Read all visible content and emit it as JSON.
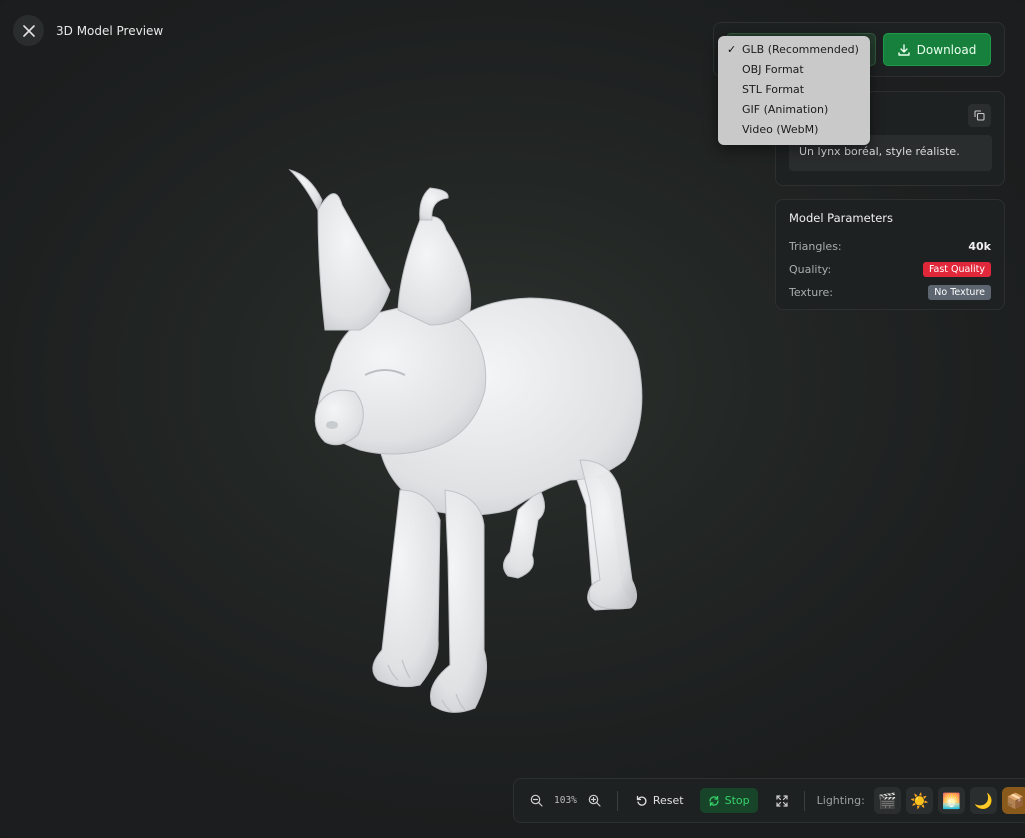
{
  "header": {
    "title": "3D Model Preview"
  },
  "download": {
    "label": "Download"
  },
  "format_menu": {
    "items": [
      {
        "label": "GLB (Recommended)",
        "checked": true
      },
      {
        "label": "OBJ Format",
        "checked": false
      },
      {
        "label": "STL Format",
        "checked": false
      },
      {
        "label": "GIF (Animation)",
        "checked": false
      },
      {
        "label": "Video (WebM)",
        "checked": false
      }
    ],
    "check_glyph": "✓"
  },
  "prompt": {
    "text": "Un lynx boréal, style réaliste."
  },
  "params": {
    "title": "Model Parameters",
    "triangles_label": "Triangles:",
    "triangles_value": "40k",
    "quality_label": "Quality:",
    "quality_value": "Fast Quality",
    "texture_label": "Texture:",
    "texture_value": "No Texture"
  },
  "toolbar": {
    "zoom_level": "103%",
    "reset_label": "Reset",
    "stop_label": "Stop",
    "lighting_label": "Lighting:",
    "lighting_presets": [
      {
        "icon": "clapper-icon",
        "glyph": "🎬",
        "active": false
      },
      {
        "icon": "sun-icon",
        "glyph": "☀️",
        "active": false
      },
      {
        "icon": "landscape-icon",
        "glyph": "🌅",
        "active": false
      },
      {
        "icon": "moon-icon",
        "glyph": "🌙",
        "active": false
      },
      {
        "icon": "box-icon",
        "glyph": "📦",
        "active": true
      }
    ]
  },
  "colors": {
    "accent_green": "#16803c",
    "quality_badge": "#e0283a",
    "texture_badge": "#5d6670"
  }
}
